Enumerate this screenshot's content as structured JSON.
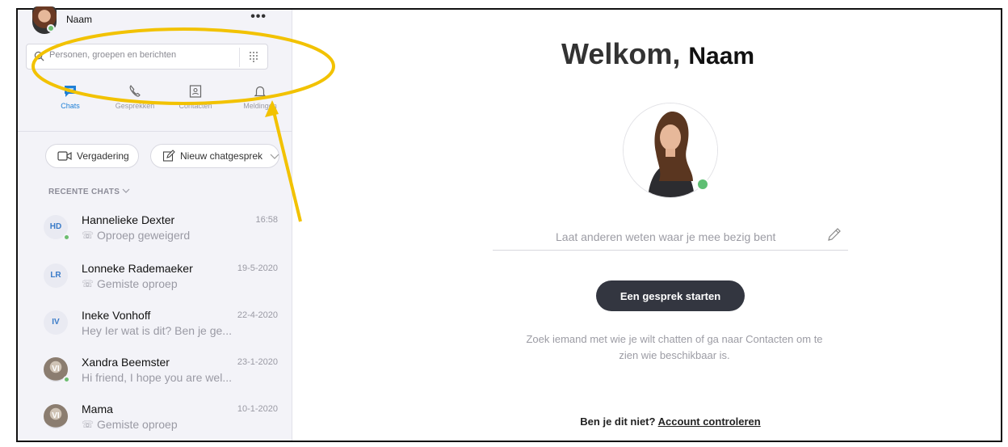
{
  "profile": {
    "name": "Naam",
    "more": "•••"
  },
  "search": {
    "placeholder": "Personen, groepen en berichten"
  },
  "nav": {
    "chats": "Chats",
    "calls": "Gesprekken",
    "contacts": "Contacten",
    "notifications": "Meldingen"
  },
  "actions": {
    "meeting": "Vergadering",
    "new_chat": "Nieuw chatgesprek"
  },
  "recent": {
    "header": "RECENTE CHATS"
  },
  "chats": [
    {
      "initials": "HD",
      "name": "Hannelieke Dexter",
      "time": "16:58",
      "sub": "Oproep geweigerd",
      "sub_icon": "☏"
    },
    {
      "initials": "LR",
      "name": "Lonneke Rademaeker",
      "time": "19-5-2020",
      "sub": "Gemiste oproep",
      "sub_icon": "☏"
    },
    {
      "initials": "IV",
      "name": "Ineke Vonhoff",
      "time": "22-4-2020",
      "sub": "Hey Ier wat is dit? Ben je ge...",
      "sub_icon": ""
    },
    {
      "initials": "VI",
      "name": "Xandra Beemster",
      "time": "23-1-2020",
      "sub": "Hi friend, I hope you are wel...",
      "sub_icon": ""
    },
    {
      "initials": "VI",
      "name": "Mama",
      "time": "10-1-2020",
      "sub": "Gemiste oproep",
      "sub_icon": "☏"
    }
  ],
  "main": {
    "welcome": "Welkom,",
    "welcome_name": "Naam",
    "mood_placeholder": "Laat anderen weten waar je mee bezig bent",
    "start_button": "Een gesprek starten",
    "hint": "Zoek iemand met wie je wilt chatten of ga naar Contacten om te zien wie beschikbaar is.",
    "not_you": "Ben je dit niet?",
    "verify_link": "Account controleren"
  },
  "colors": {
    "accent": "#1e7fd6",
    "online": "#6cbd6f",
    "annotation": "#f2c200",
    "button": "#333640"
  }
}
